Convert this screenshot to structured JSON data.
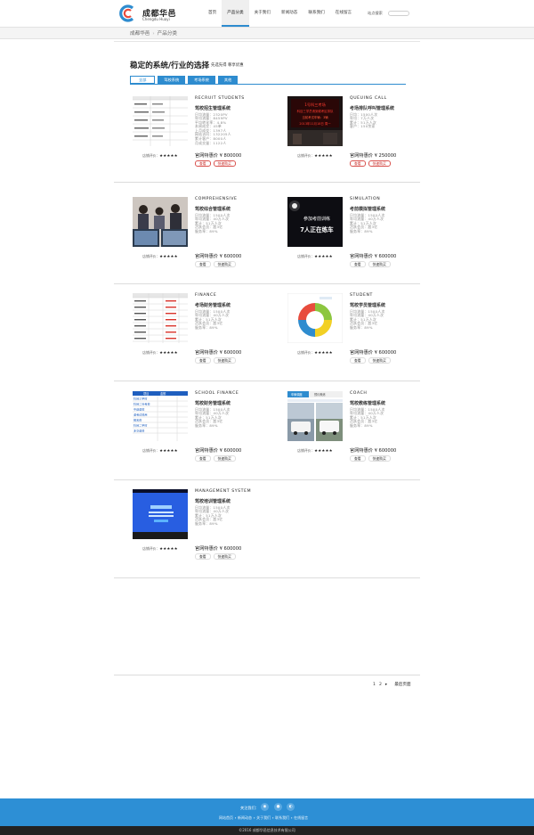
{
  "header": {
    "logo_cn": "成都华邑",
    "logo_en": "Chengdu Huayi",
    "nav": [
      "首页",
      "产品分类",
      "关于我们",
      "新闻动态",
      "联系我们",
      "在线留言"
    ],
    "search_label": "站点搜索"
  },
  "breadcrumb": {
    "home": "成都华邑",
    "current": "产品分类"
  },
  "section": {
    "title": "稳定的系统/行业的选择",
    "subtitle": "先选先得 尊享优惠",
    "tabs": [
      "全部",
      "驾校系统",
      "考场系统",
      "其他"
    ]
  },
  "products": [
    {
      "en": "RECRUIT STUDENTS",
      "cn": "驾校招生管理系统",
      "specs": [
        "日均流量：2320PV",
        "年均流量：8459PV",
        "平均转化率：4.8%",
        "本周成交：45单",
        "上月成交：1397人",
        "网站访问：132205人",
        "累计客户：8000人",
        "月成交量：1122人"
      ],
      "rating_label": "店铺评价：",
      "stars": "★★★★★",
      "price": "官网特惠价 ¥ 800000",
      "buttons": [
        "查看",
        "快速购买"
      ],
      "highlight": true
    },
    {
      "en": "QUEUING CALL",
      "cn": "考场排队呼叫管理系统",
      "specs": [
        "日均：1500人次",
        "年均：7万人次",
        "累计：51万人次",
        "客户：150余家"
      ],
      "rating_label": "店铺评价：",
      "stars": "★★★★★",
      "price": "官网特惠价 ¥ 250000",
      "buttons": [
        "查看",
        "快速购买"
      ],
      "highlight": true,
      "screen_lines": [
        "1号科三考场",
        "科目三学员请到候考区排队",
        "当前考试车辆：3辆 ",
        "2013年11月18日 周一"
      ]
    },
    {
      "en": "COMPREHENSIVE",
      "cn": "驾校综合管理系统",
      "specs": [
        "日均流量：1500人次",
        "年均流量：40万人次",
        "累计：51万人次",
        "活跃会员：超3亿",
        "服务率：89%"
      ],
      "rating_label": "店铺评价：",
      "stars": "★★★★★",
      "price": "官网特惠价 ¥ 600000",
      "buttons": [
        "查看",
        "快速购买"
      ],
      "highlight": false
    },
    {
      "en": "SIMULATION",
      "cn": "考前模拟管理系统",
      "specs": [
        "日均流量：1500人次",
        "年均流量：40万人次",
        "累计：51万人次",
        "活跃会员：超3亿",
        "服务率：89%"
      ],
      "rating_label": "店铺评价：",
      "stars": "★★★★★",
      "price": "官网特惠价 ¥ 600000",
      "buttons": [
        "查看",
        "快速购买"
      ],
      "highlight": false,
      "screen_lines": [
        "参加考前训练",
        "7人正在练车"
      ]
    },
    {
      "en": "FINANCE",
      "cn": "考场财务管理系统",
      "specs": [
        "日均流量：1500人次",
        "年均流量：40万人次",
        "累计：51万人次",
        "活跃会员：超3亿",
        "服务率：89%"
      ],
      "rating_label": "店铺评价：",
      "stars": "★★★★★",
      "price": "官网特惠价 ¥ 600000",
      "buttons": [
        "查看",
        "快速购买"
      ],
      "highlight": false
    },
    {
      "en": "STUDENT",
      "cn": "驾校学员管理系统",
      "specs": [
        "日均流量：1500人次",
        "年均流量：40万人次",
        "累计：51万人次",
        "活跃会员：超3亿",
        "服务率：89%"
      ],
      "rating_label": "店铺评价：",
      "stars": "★★★★★",
      "price": "官网特惠价 ¥ 600000",
      "buttons": [
        "查看",
        "快速购买"
      ],
      "highlight": false
    },
    {
      "en": "SCHOOL FINANCE",
      "cn": "驾校财务管理系统",
      "specs": [
        "日均流量：1500人次",
        "年均流量：40万人次",
        "累计：51万人次",
        "活跃会员：超3亿",
        "服务率：89%"
      ],
      "rating_label": "店铺评价：",
      "stars": "★★★★★",
      "price": "官网特惠价 ¥ 600000",
      "buttons": [
        "查看",
        "快速购买"
      ],
      "highlight": false,
      "menu_header": [
        "项目",
        "金额"
      ],
      "menu_items": [
        "科目三学时",
        "科目二补考费",
        "中途退款",
        "退考试费用",
        "报名费",
        "科目二学时",
        "多交退费"
      ]
    },
    {
      "en": "COACH",
      "cn": "驾校教练管理系统",
      "specs": [
        "日均流量：1500人次",
        "年均流量：40万人次",
        "累计：51万人次",
        "活跃会员：超3亿",
        "服务率：89%"
      ],
      "rating_label": "店铺评价：",
      "stars": "★★★★★",
      "price": "官网特惠价 ¥ 600000",
      "buttons": [
        "查看",
        "快速购买"
      ],
      "highlight": false,
      "tabs": [
        "车辆调度",
        "预约教练"
      ]
    },
    {
      "en": "MANAGEMENT SYSTEM",
      "cn": "驾校培训管理系统",
      "specs": [
        "日均流量：1500人次",
        "年均流量：40万人次",
        "累计：51万人次",
        "活跃会员：超3亿",
        "服务率：89%"
      ],
      "rating_label": "店铺评价：",
      "stars": "★★★★★",
      "price": "官网特惠价 ¥ 600000",
      "buttons": [
        "查看",
        "快速购买"
      ],
      "highlight": false
    }
  ],
  "pagination": {
    "pages": [
      "1",
      "2"
    ],
    "next": "▸",
    "last": "最后页面"
  },
  "footer": {
    "follow": "关注我们：",
    "links": "网站首页 ∙ 新闻动态 ∙ 关于我们 ∙ 联系我们 ∙ 在线留言",
    "copyright": "©2016 成都华邑信息技术有限公司"
  },
  "colors": {
    "accent": "#2e8ccf",
    "footer": "#2d8fd5",
    "buy_red": "#c9302c"
  }
}
